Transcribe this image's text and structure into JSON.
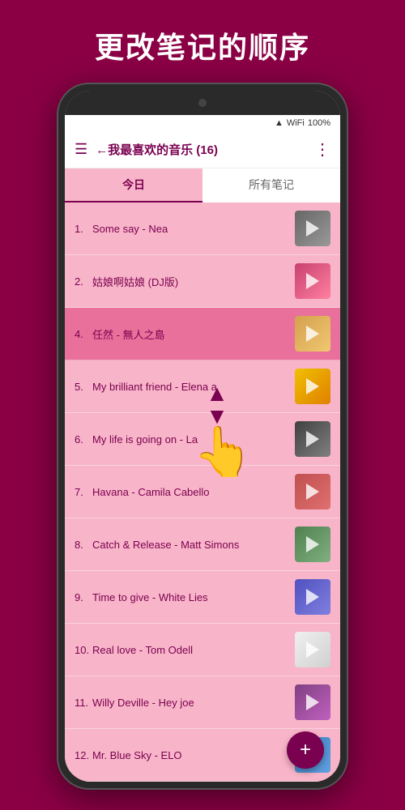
{
  "page": {
    "bg_color": "#8B0045",
    "title": "更改笔记的顺序"
  },
  "status_bar": {
    "signal": "▲▲▲",
    "wifi": "WiFi",
    "battery": "100%"
  },
  "top_bar": {
    "menu_icon": "☰",
    "back_label": "←我最喜欢的音乐 (16)",
    "more_icon": "⋮"
  },
  "tabs": [
    {
      "id": "today",
      "label": "今日",
      "active": true
    },
    {
      "id": "all",
      "label": "所有笔记",
      "active": false
    }
  ],
  "songs": [
    {
      "number": "1.",
      "title": "Some say - Nea",
      "thumb_class": "thumb-1",
      "highlighted": false
    },
    {
      "number": "2.",
      "title": "姑娘啊姑娘 (DJ版)",
      "thumb_class": "thumb-2",
      "highlighted": false
    },
    {
      "number": "4.",
      "title": "任然 - 無人之島",
      "thumb_class": "thumb-4",
      "highlighted": true
    },
    {
      "number": "5.",
      "title": "My brilliant friend - Elena a",
      "thumb_class": "thumb-5",
      "highlighted": false
    },
    {
      "number": "6.",
      "title": "My life is going on - La",
      "thumb_class": "thumb-6",
      "highlighted": false
    },
    {
      "number": "7.",
      "title": "Havana - Camila Cabello",
      "thumb_class": "thumb-7",
      "highlighted": false
    },
    {
      "number": "8.",
      "title": "Catch & Release - Matt Simons",
      "thumb_class": "thumb-8",
      "highlighted": false
    },
    {
      "number": "9.",
      "title": "Time to give - White Lies",
      "thumb_class": "thumb-9",
      "highlighted": false
    },
    {
      "number": "10.",
      "title": "Real love - Tom Odell",
      "thumb_class": "thumb-10",
      "highlighted": false
    },
    {
      "number": "11.",
      "title": "Willy Deville - Hey joe",
      "thumb_class": "thumb-11",
      "highlighted": false
    },
    {
      "number": "12.",
      "title": "Mr. Blue Sky - ELO",
      "thumb_class": "thumb-12",
      "highlighted": false
    }
  ],
  "fab": {
    "icon": "+",
    "label": "Add"
  }
}
